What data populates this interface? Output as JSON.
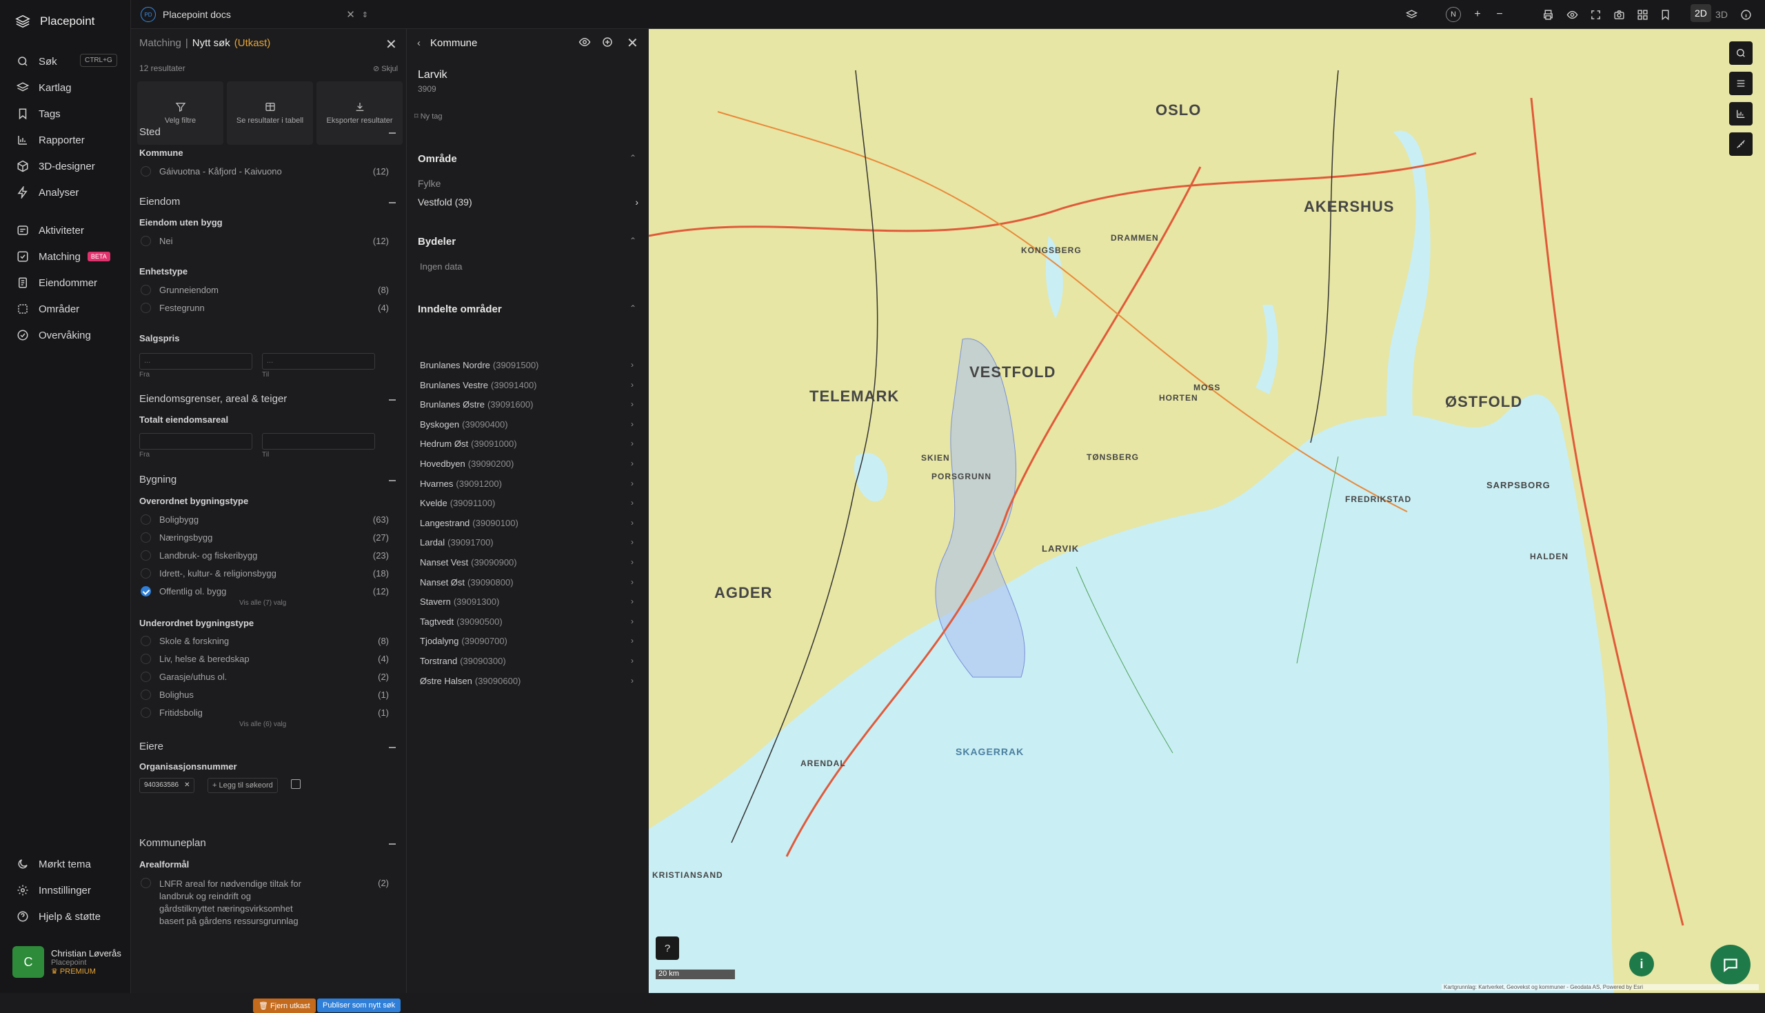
{
  "app": {
    "name": "Placepoint"
  },
  "sidebar": {
    "search_label": "Søk",
    "search_shortcut": "CTRL+G",
    "items": [
      {
        "label": "Kartlag"
      },
      {
        "label": "Tags"
      },
      {
        "label": "Rapporter"
      },
      {
        "label": "3D-designer"
      },
      {
        "label": "Analyser"
      },
      {
        "label": "Aktiviteter"
      },
      {
        "label": "Matching",
        "badge": "BETA"
      },
      {
        "label": "Eiendommer"
      },
      {
        "label": "Områder"
      },
      {
        "label": "Overvåking"
      }
    ],
    "bottom": [
      {
        "label": "Mørkt tema"
      },
      {
        "label": "Innstillinger"
      },
      {
        "label": "Hjelp & støtte"
      }
    ],
    "user": {
      "initial": "C",
      "name": "Christian Løverås",
      "company": "Placepoint",
      "plan": "PREMIUM"
    }
  },
  "topbar": {
    "doc_initials": "PD",
    "doc_name": "Placepoint docs",
    "north": "N",
    "mode_2d": "2D",
    "mode_3d": "3D"
  },
  "matching": {
    "crumb": "Matching",
    "sep": "|",
    "title": "Nytt søk",
    "status": "(Utkast)",
    "result_count": "12 resultater",
    "hide_label": "Skjul",
    "actions": [
      "Velg filtre",
      "Se resultater i tabell",
      "Eksporter resultater"
    ],
    "sections": {
      "sted": "Sted",
      "kommune_label": "Kommune",
      "kommune_opt": {
        "label": "Gáivuotna - Kåfjord - Kaivuono",
        "count": "(12)"
      },
      "eiendom": "Eiendom",
      "uten_bygg_label": "Eiendom uten bygg",
      "uten_bygg_opt": {
        "label": "Nei",
        "count": "(12)"
      },
      "enhetstype_label": "Enhetstype",
      "enhetstype_opts": [
        {
          "label": "Grunneiendom",
          "count": "(8)"
        },
        {
          "label": "Festegrunn",
          "count": "(4)"
        }
      ],
      "salgspris_label": "Salgspris",
      "from": "Fra",
      "to": "Til",
      "range_placeholder": "...",
      "grenser": "Eiendomsgrenser, areal & teiger",
      "totalt_label": "Totalt eiendomsareal",
      "bygning": "Bygning",
      "overordnet_label": "Overordnet bygningstype",
      "overordnet_opts": [
        {
          "label": "Boligbygg",
          "count": "(63)"
        },
        {
          "label": "Næringsbygg",
          "count": "(27)"
        },
        {
          "label": "Landbruk- og fiskeribygg",
          "count": "(23)"
        },
        {
          "label": "Idrett-, kultur- & religionsbygg",
          "count": "(18)"
        },
        {
          "label": "Offentlig ol. bygg",
          "count": "(12)"
        }
      ],
      "vis_alle_7": "Vis alle (7) valg",
      "underordnet_label": "Underordnet bygningstype",
      "underordnet_opts": [
        {
          "label": "Skole & forskning",
          "count": "(8)"
        },
        {
          "label": "Liv, helse & beredskap",
          "count": "(4)"
        },
        {
          "label": "Garasje/uthus ol.",
          "count": "(2)"
        },
        {
          "label": "Bolighus",
          "count": "(1)"
        },
        {
          "label": "Fritidsbolig",
          "count": "(1)"
        }
      ],
      "vis_alle_6": "Vis alle (6) valg",
      "eiere": "Eiere",
      "orgnr_label": "Organisasjonsnummer",
      "orgnr_tag": "940363586",
      "add_keyword": "Legg til søkeord",
      "kommuneplan": "Kommuneplan",
      "arealformal_label": "Arealformål",
      "arealformal_lines": [
        "LNFR areal for nødvendige tiltak for",
        "landbruk og reindrift og",
        "gårdstilknyttet næringsvirksomhet",
        "basert på gårdens ressursgrunnlag"
      ],
      "arealformal_count": "(2)"
    },
    "buttons": {
      "remove": "Fjern utkast",
      "publish": "Publiser som nytt søk"
    }
  },
  "kommune_panel": {
    "header": "Kommune",
    "name": "Larvik",
    "number": "3909",
    "new_tag": "Ny tag",
    "omrade_title": "Område",
    "fylke_label": "Fylke",
    "fylke_value": "Vestfold (39)",
    "bydeler_title": "Bydeler",
    "bydeler_empty": "Ingen data",
    "inndelte_title": "Inndelte områder",
    "areas": [
      {
        "name": "Brunlanes Nordre",
        "code": "(39091500)"
      },
      {
        "name": "Brunlanes Vestre",
        "code": "(39091400)"
      },
      {
        "name": "Brunlanes Østre",
        "code": "(39091600)"
      },
      {
        "name": "Byskogen",
        "code": "(39090400)"
      },
      {
        "name": "Hedrum Øst",
        "code": "(39091000)"
      },
      {
        "name": "Hovedbyen",
        "code": "(39090200)"
      },
      {
        "name": "Hvarnes",
        "code": "(39091200)"
      },
      {
        "name": "Kvelde",
        "code": "(39091100)"
      },
      {
        "name": "Langestrand",
        "code": "(39090100)"
      },
      {
        "name": "Lardal",
        "code": "(39091700)"
      },
      {
        "name": "Nanset Vest",
        "code": "(39090900)"
      },
      {
        "name": "Nanset Øst",
        "code": "(39090800)"
      },
      {
        "name": "Stavern",
        "code": "(39091300)"
      },
      {
        "name": "Tagtvedt",
        "code": "(39090500)"
      },
      {
        "name": "Tjodalyng",
        "code": "(39090700)"
      },
      {
        "name": "Torstrand",
        "code": "(39090300)"
      },
      {
        "name": "Østre Halsen",
        "code": "(39090600)"
      }
    ]
  },
  "map": {
    "places": [
      "OSLO",
      "AKERSHUS",
      "VESTFOLD",
      "TELEMARK",
      "ØSTFOLD",
      "AGDER",
      "SKAGERRAK",
      "LARVIK",
      "KONGSBERG",
      "DRAMMEN",
      "HORTEN",
      "MOSS",
      "TØNSBERG",
      "SARPSBORG",
      "FREDRIKSTAD",
      "HALDEN",
      "SKIEN",
      "PORSGRUNN",
      "ARENDAL",
      "KRISTIANSAND"
    ],
    "scale_label": "20 km",
    "attribution": "Kartgrunnlag: Kartverket, Geovekst og kommuner - Geodata AS, Powered by Esri",
    "colors": {
      "land": "#e7e6a4",
      "water": "#c9eef4",
      "highlight": "#a9bff0"
    }
  }
}
